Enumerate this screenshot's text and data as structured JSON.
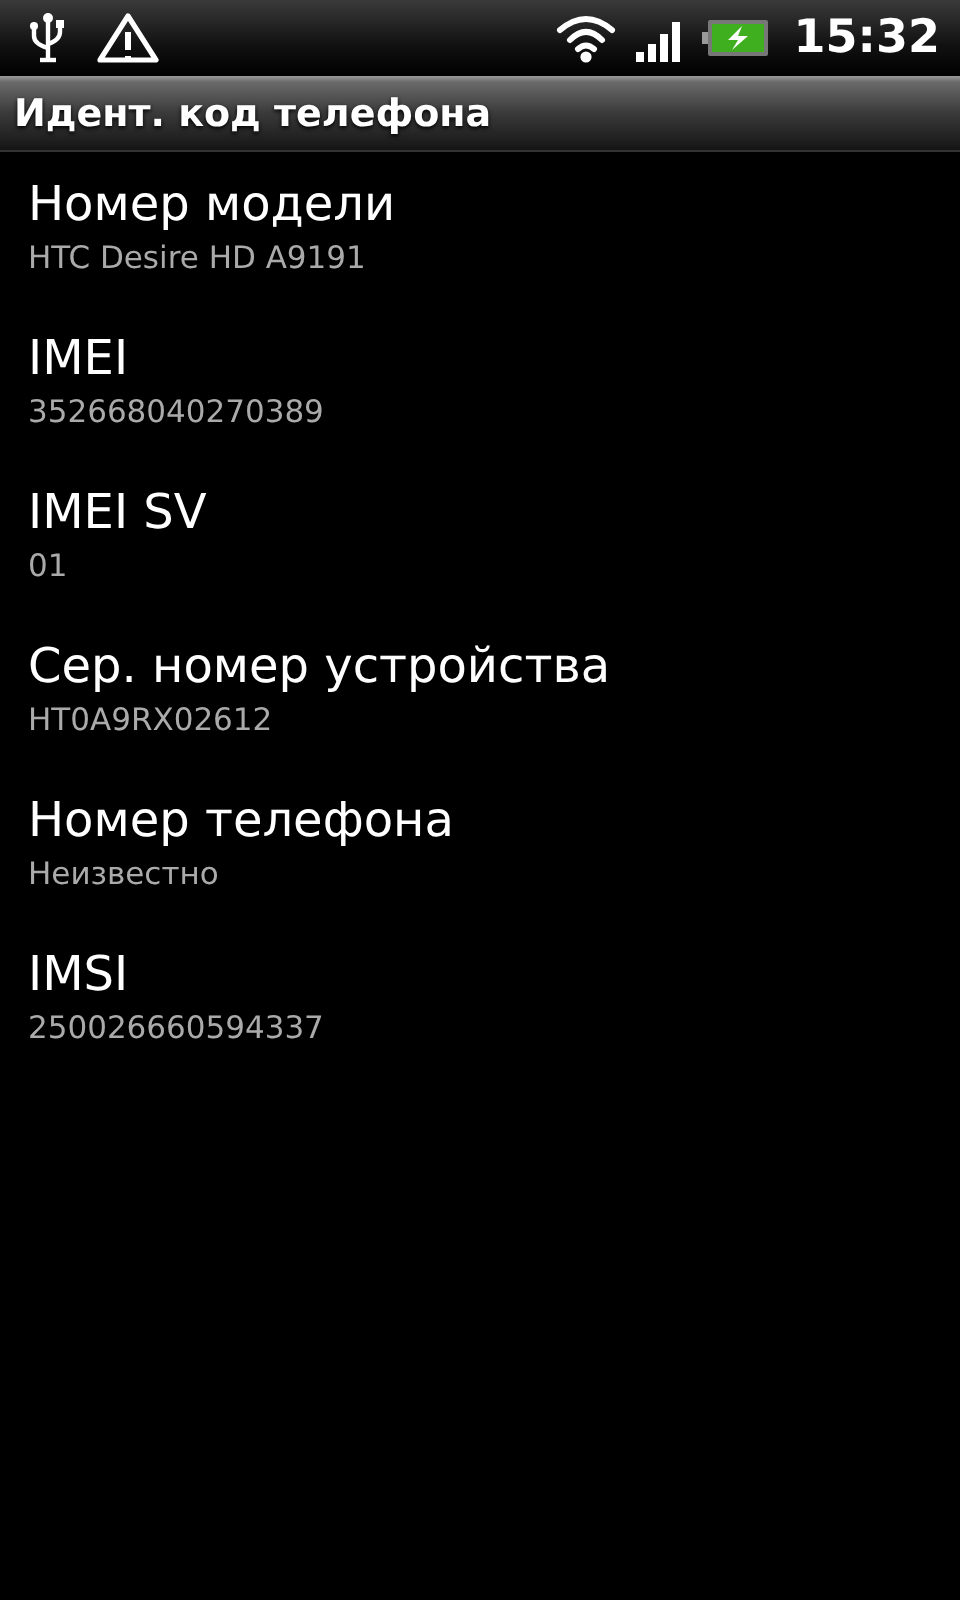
{
  "status_bar": {
    "time": "15:32",
    "battery_charging": true
  },
  "title_bar": {
    "title": "Идент. код телефона"
  },
  "items": [
    {
      "label": "Номер модели",
      "value": "HTC Desire HD A9191"
    },
    {
      "label": "IMEI",
      "value": "352668040270389"
    },
    {
      "label": "IMEI SV",
      "value": "01"
    },
    {
      "label": "Сер. номер устройства",
      "value": "HT0A9RX02612"
    },
    {
      "label": "Номер телефона",
      "value": "Неизвестно"
    },
    {
      "label": "IMSI",
      "value": "250026660594337"
    }
  ]
}
